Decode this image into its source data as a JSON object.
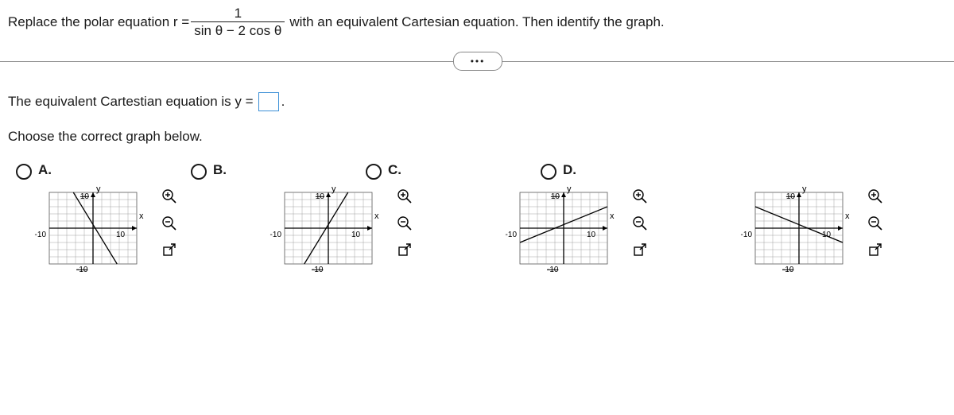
{
  "question": {
    "pre": "Replace the polar equation r =",
    "frac_num": "1",
    "frac_den": "sin θ − 2 cos θ",
    "post": "with an equivalent Cartesian equation. Then identify the graph."
  },
  "answer_prompt": {
    "pre": "The equivalent Cartestian equation is y =",
    "box_value": "",
    "after": "."
  },
  "choose_label": "Choose the correct graph below.",
  "options": {
    "a": "A.",
    "b": "B.",
    "c": "C.",
    "d": "D."
  },
  "axis": {
    "y": "y",
    "x": "x",
    "p10": "10",
    "n10": "-10",
    "top10": "10",
    "bot10": "-10"
  },
  "ellipsis": "•••",
  "chart_data": [
    {
      "type": "line",
      "id": "A",
      "xlim": [
        -10,
        10
      ],
      "ylim": [
        -10,
        10
      ],
      "xlabel": "x",
      "ylabel": "y",
      "tick_x": [
        -10,
        10
      ],
      "tick_y": [
        -10,
        10
      ],
      "series": [
        {
          "name": "line",
          "equation": "y = -2x + 1",
          "x": [
            -4.5,
            5.5
          ],
          "y": [
            10,
            -10
          ]
        }
      ],
      "grid": true
    },
    {
      "type": "line",
      "id": "B",
      "xlim": [
        -10,
        10
      ],
      "ylim": [
        -10,
        10
      ],
      "xlabel": "x",
      "ylabel": "y",
      "tick_x": [
        -10,
        10
      ],
      "tick_y": [
        -10,
        10
      ],
      "series": [
        {
          "name": "line",
          "equation": "y = 2x + 1",
          "x": [
            -5.5,
            4.5
          ],
          "y": [
            -10,
            10
          ]
        }
      ],
      "grid": true
    },
    {
      "type": "line",
      "id": "C",
      "xlim": [
        -10,
        10
      ],
      "ylim": [
        -10,
        10
      ],
      "xlabel": "x",
      "ylabel": "y",
      "tick_x": [
        -10,
        10
      ],
      "tick_y": [
        -10,
        10
      ],
      "series": [
        {
          "name": "line",
          "equation": "y = 0.5x + 1",
          "x": [
            -10,
            10
          ],
          "y": [
            -4,
            6
          ]
        }
      ],
      "grid": true
    },
    {
      "type": "line",
      "id": "D",
      "xlim": [
        -10,
        10
      ],
      "ylim": [
        -10,
        10
      ],
      "xlabel": "x",
      "ylabel": "y",
      "tick_x": [
        -10,
        10
      ],
      "tick_y": [
        -10,
        10
      ],
      "series": [
        {
          "name": "line",
          "equation": "y = -0.5x + 1",
          "x": [
            -10,
            10
          ],
          "y": [
            6,
            -4
          ]
        }
      ],
      "grid": true
    }
  ]
}
